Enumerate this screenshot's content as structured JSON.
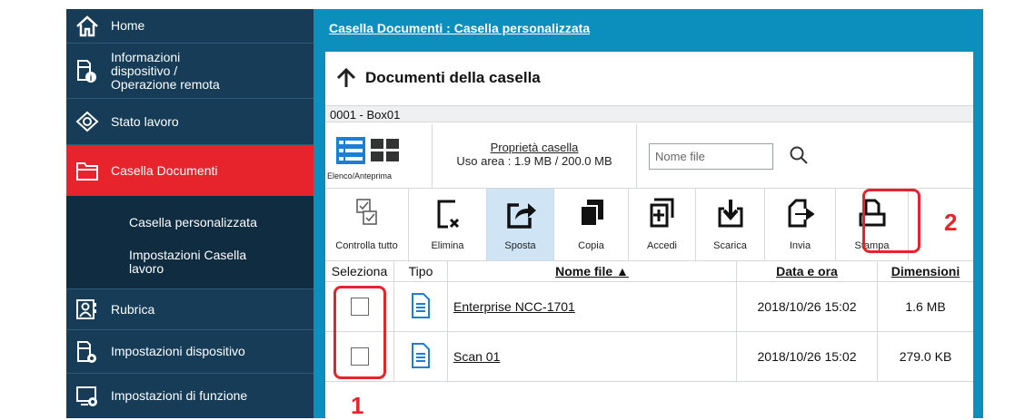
{
  "sidebar": {
    "home": "Home",
    "device_info": [
      "Informazioni",
      "dispositivo /",
      "Operazione remota"
    ],
    "job_status": "Stato lavoro",
    "document_box": "Casella Documenti",
    "sub_items": [
      "Casella personalizzata",
      "Impostazioni Casella",
      "lavoro"
    ],
    "address_book": "Rubrica",
    "device_settings": "Impostazioni dispositivo",
    "function_settings": "Impostazioni di funzione"
  },
  "breadcrumb": "Casella Documenti : Casella personalizzata",
  "header": {
    "title": "Documenti della casella"
  },
  "box_id": "0001 - Box01",
  "view": {
    "label": "Elenco/Anteprima"
  },
  "properties": {
    "link": "Proprietà casella",
    "usage": "Uso area : 1.9 MB / 200.0 MB"
  },
  "search": {
    "placeholder": "Nome file"
  },
  "toolbar": {
    "check_all": "Controlla tutto",
    "delete": "Elimina",
    "move": "Sposta",
    "copy": "Copia",
    "join": "Accedi",
    "download": "Scarica",
    "send": "Invia",
    "print": "Stampa"
  },
  "table": {
    "columns": {
      "select": "Seleziona",
      "type": "Tipo",
      "name": "Nome file ▲",
      "date": "Data e ora",
      "size": "Dimensioni"
    },
    "rows": [
      {
        "name": "Enterprise NCC-1701",
        "date": "2018/10/26 15:02",
        "size": "1.6 MB"
      },
      {
        "name": "Scan 01",
        "date": "2018/10/26 15:02",
        "size": "279.0 KB"
      }
    ]
  },
  "callouts": {
    "one": "1",
    "two": "2"
  },
  "colors": {
    "accent_red": "#e7242c",
    "sidebar": "#163c57",
    "background": "#0d8fbd",
    "selected_tool": "#cfe5f6"
  }
}
